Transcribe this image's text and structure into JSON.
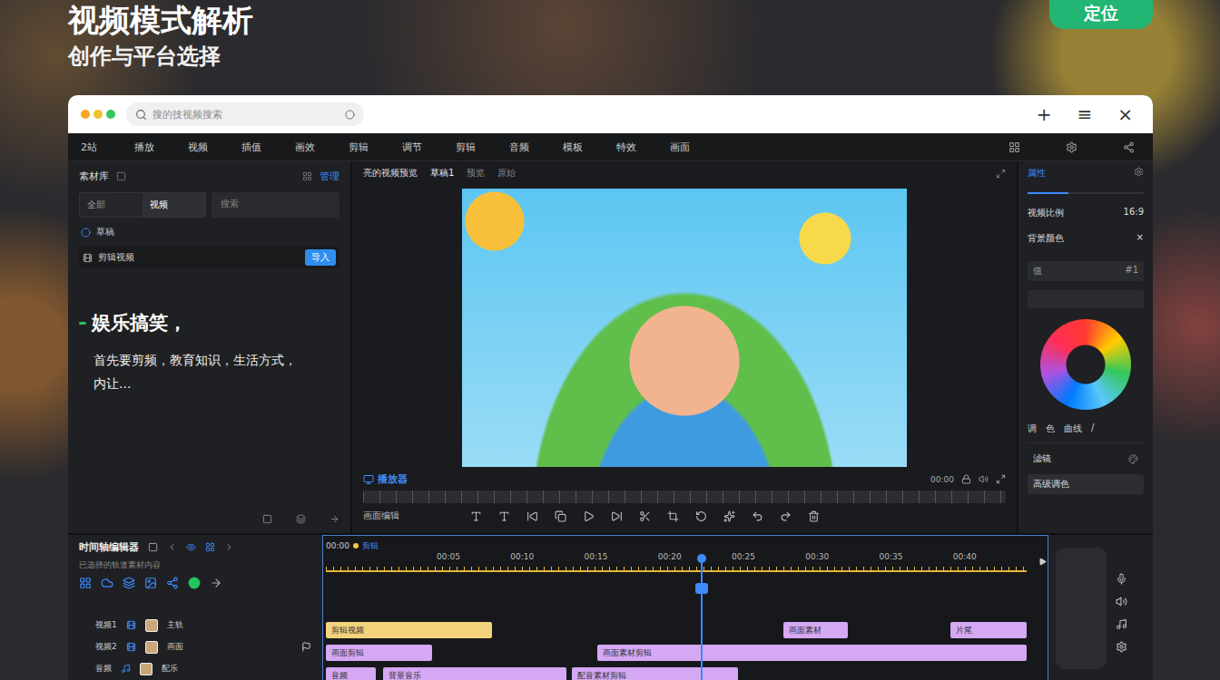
{
  "page": {
    "title": "视频模式解析",
    "subtitle": "创作与平台选择",
    "action_button": "定位"
  },
  "window": {
    "search_placeholder": "搜的技视频搜索",
    "controls": [
      "+",
      "≡",
      "×"
    ]
  },
  "menu": [
    "2站",
    "播放",
    "视频",
    "插值",
    "画效",
    "剪辑",
    "调节",
    "剪辑",
    "音频",
    "模板",
    "特效",
    "画面"
  ],
  "left_panel": {
    "title": "素材库",
    "link": "管理",
    "tabs": [
      {
        "label": "全部",
        "selected": false
      },
      {
        "label": "视频",
        "selected": true
      }
    ],
    "search_placeholder": "搜索",
    "draft": "草稿",
    "import_row": {
      "label": "剪辑视频",
      "button": "导入"
    },
    "heading": "娱乐搞笑，",
    "body_lines": [
      "首先要剪频，教育知识，生活方式，",
      "内让..."
    ]
  },
  "preview": {
    "title": "亮的视频预览",
    "tabs": [
      {
        "label": "草稿1",
        "selected": true
      },
      {
        "label": "预览",
        "selected": false
      },
      {
        "label": "原始",
        "selected": false
      }
    ],
    "player_label": "播放器",
    "time": "00:00",
    "edit_label": "画面编辑"
  },
  "right_panel": {
    "title": "属性",
    "level": 0.35,
    "rows": [
      {
        "label": "视频比例",
        "value": "16:9"
      },
      {
        "label": "背景颜色",
        "value": "×"
      }
    ],
    "fields": [
      {
        "label": "值",
        "value": "#1"
      }
    ],
    "tools": [
      "调",
      "色",
      "曲线",
      "/"
    ],
    "options": [
      {
        "label": "滤镜",
        "selected": false
      },
      {
        "label": "高级调色",
        "selected": true
      }
    ]
  },
  "timeline": {
    "title": "时间轴编辑器",
    "subtitle": "已选择的轨道素材内容",
    "time": "00:00",
    "track_label": "剪辑",
    "ticks": [
      "00:05",
      "00:10",
      "00:15",
      "00:20",
      "00:25",
      "00:30",
      "00:35",
      "00:40"
    ],
    "duration": 49,
    "playhead": 0.535,
    "ruler_level": 1,
    "tracks": [
      {
        "name": "视频1",
        "type": "主轨",
        "flag": false,
        "clips": [
          {
            "label": "剪辑视频",
            "start": 0,
            "end": 11.6,
            "color": "#f3d37c"
          },
          {
            "label": "画面素材",
            "start": 32,
            "end": 36.5,
            "color": "#d4a8f2"
          },
          {
            "label": "片尾",
            "start": 43.7,
            "end": 49,
            "color": "#d4a8f2"
          }
        ]
      },
      {
        "name": "视频2",
        "type": "画面",
        "flag": true,
        "clips": [
          {
            "label": "画面剪辑",
            "start": 0,
            "end": 7.4,
            "color": "#d4a8f2"
          },
          {
            "label": "画面素材剪辑",
            "start": 19,
            "end": 49,
            "color": "#d4a8f2"
          }
        ]
      },
      {
        "name": "音频",
        "type": "配乐",
        "flag": false,
        "clips": [
          {
            "label": "音频",
            "start": 0,
            "end": 3.5,
            "color": "#d4a8f2"
          },
          {
            "label": "背景音乐",
            "start": 4,
            "end": 16.8,
            "color": "#d4a8f2"
          },
          {
            "label": "配音素材剪辑",
            "start": 17.2,
            "end": 28.8,
            "color": "#d4a8f2"
          }
        ]
      }
    ]
  }
}
